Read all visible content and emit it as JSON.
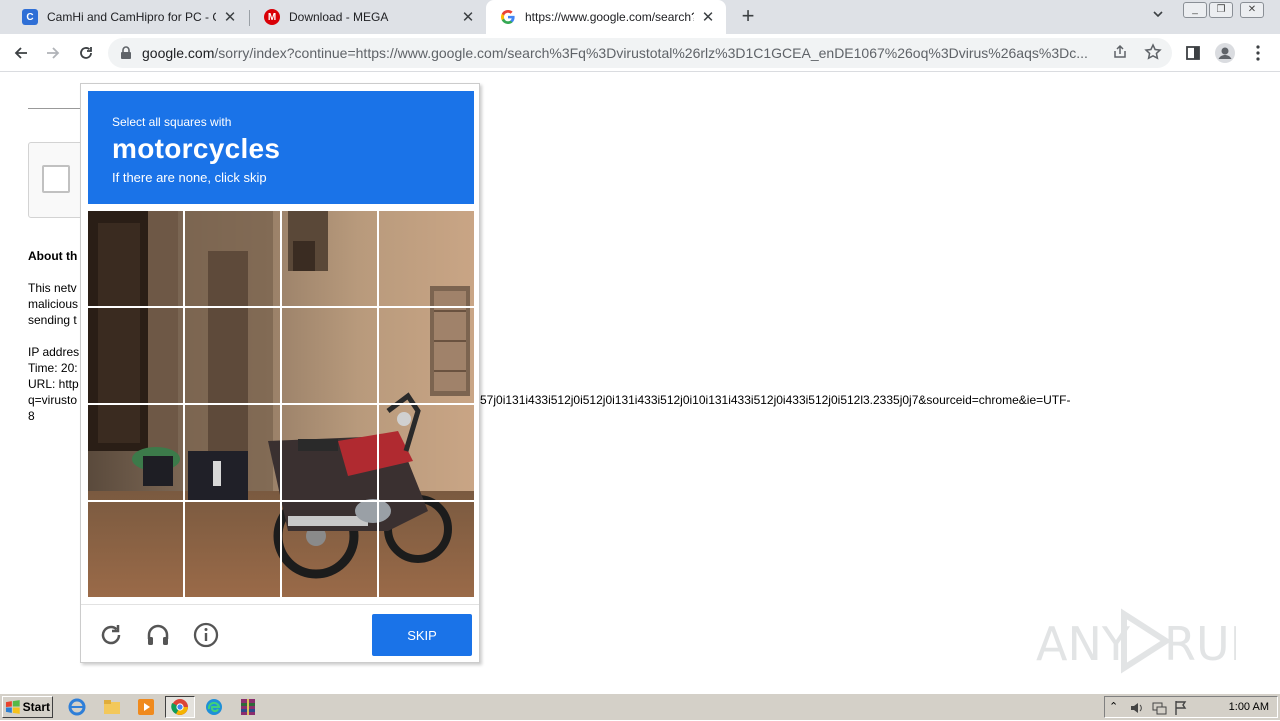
{
  "browser": {
    "tabs": [
      {
        "title": "CamHi and CamHipro for PC - Camhi",
        "icon": "camhi-favicon",
        "active": false
      },
      {
        "title": "Download - MEGA",
        "icon": "mega-favicon",
        "active": false
      },
      {
        "title": "https://www.google.com/search?q=",
        "icon": "google-favicon",
        "active": true
      }
    ],
    "new_tab_label": "+",
    "close_glyph": "✕",
    "url": {
      "host": "google.com",
      "rest": "/sorry/index?continue=https://www.google.com/search%3Fq%3Dvirustotal%26rlz%3D1C1GCEA_enDE1067%26oq%3Dvirus%26aqs%3Dc..."
    }
  },
  "page": {
    "about_title": "About th",
    "para1": [
      "This netv",
      "malicious",
      "sending t"
    ],
    "info_lines": [
      "IP addres",
      "Time: 20:",
      "URL: http",
      "q=virusto"
    ],
    "url_tail": "57j0i131i433i512j0i512j0i131i433i512j0i10i131i433i512j0i433i512j0i512l3.2335j0j7&sourceid=chrome&ie=UTF-",
    "url_tail2": "8"
  },
  "captcha": {
    "instruction_small": "Select all squares with",
    "target": "motorcycles",
    "hint": "If there are none, click skip",
    "grid_rows": 4,
    "grid_cols": 4,
    "skip_label": "SKIP",
    "accent_color": "#1a73e8"
  },
  "watermark": {
    "part1": "ANY",
    "part2": "RUN"
  },
  "taskbar": {
    "start_label": "Start",
    "clock": "1:00 AM",
    "apps": [
      "ie-icon",
      "explorer-icon",
      "media-player-icon",
      "chrome-icon",
      "edge-icon",
      "winrar-icon"
    ]
  }
}
